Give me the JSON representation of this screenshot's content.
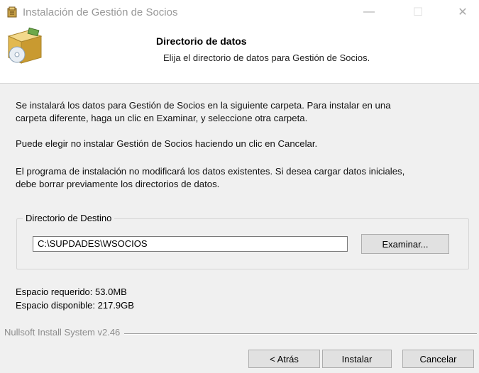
{
  "window": {
    "title": "Instalación de Gestión de Socios",
    "minimize_glyph": "—",
    "maximize_glyph": "☐",
    "close_glyph": "✕",
    "title_icon": "installer-icon"
  },
  "header": {
    "title": "Directorio de datos",
    "subtitle": "Elija el directorio de datos para Gestión de Socios.",
    "icon": "install-box-cd-icon"
  },
  "body": {
    "para1_line1": "Se instalará los datos para Gestión de Socios en la siguiente carpeta. Para instalar en una",
    "para1_line2": "carpeta diferente, haga un clic en Examinar, y seleccione otra carpeta.",
    "para2": "Puede elegir no instalar Gestión de Socios haciendo un clic en Cancelar.",
    "para3_line1": "El programa de instalación no modificará los datos existentes. Si desea cargar datos iniciales,",
    "para3_line2": "debe borrar previamente los directorios de datos."
  },
  "destination": {
    "group_label": "Directorio de Destino",
    "path_value": "C:\\SUPDADES\\WSOCIOS",
    "browse_label": "Examinar..."
  },
  "space": {
    "required": "Espacio requerido: 53.0MB",
    "available": "Espacio disponible: 217.9GB"
  },
  "footer": {
    "branding": "Nullsoft Install System v2.46",
    "back_label": "< Atrás",
    "install_label": "Instalar",
    "cancel_label": "Cancelar"
  }
}
